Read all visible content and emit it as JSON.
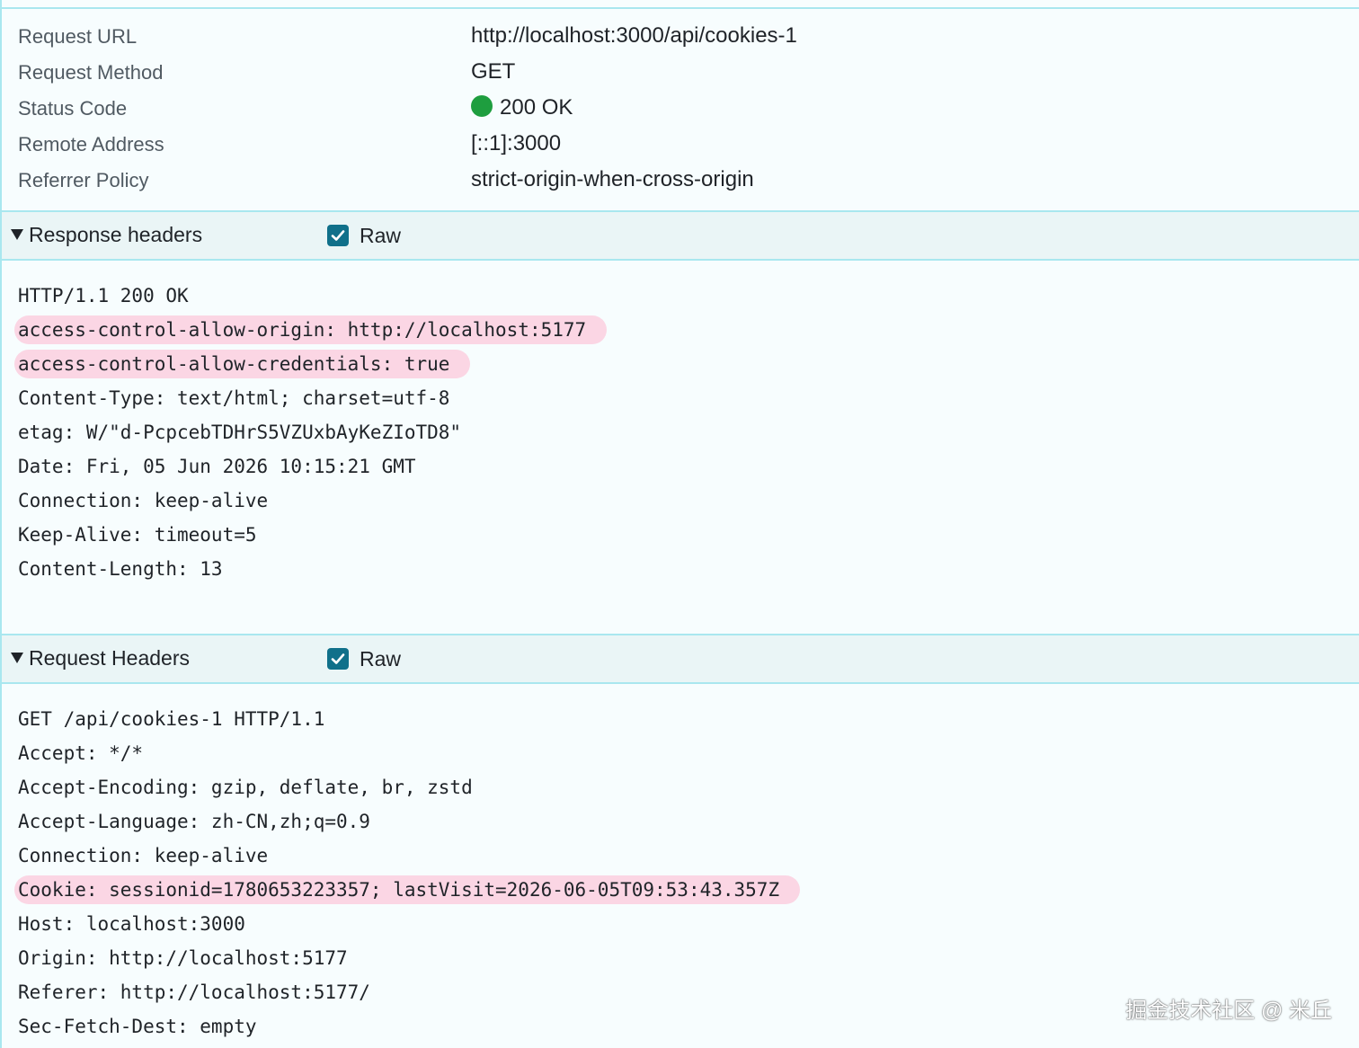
{
  "general": [
    {
      "key": "Request URL",
      "value": "http://localhost:3000/api/cookies-1"
    },
    {
      "key": "Request Method",
      "value": "GET"
    },
    {
      "key": "Status Code",
      "value": "200 OK"
    },
    {
      "key": "Remote Address",
      "value": "[::1]:3000"
    },
    {
      "key": "Referrer Policy",
      "value": "strict-origin-when-cross-origin"
    }
  ],
  "status_color": "#1e9e3f",
  "highlight_color": "#fbd6e4",
  "response_headers": {
    "title": "Response headers",
    "raw_label": "Raw",
    "raw_checked": true,
    "lines": [
      "HTTP/1.1 200 OK",
      "access-control-allow-origin: http://localhost:5177",
      "access-control-allow-credentials: true",
      "Content-Type: text/html; charset=utf-8",
      "etag: W/\"d-PcpcebTDHrS5VZUxbAyKeZIoTD8\"",
      "Date: Fri, 05 Jun 2026 10:15:21 GMT",
      "Connection: keep-alive",
      "Keep-Alive: timeout=5",
      "Content-Length: 13"
    ],
    "highlighted": [
      1,
      2
    ]
  },
  "request_headers": {
    "title": "Request Headers",
    "raw_label": "Raw",
    "raw_checked": true,
    "lines": [
      "GET /api/cookies-1 HTTP/1.1",
      "Accept: */*",
      "Accept-Encoding: gzip, deflate, br, zstd",
      "Accept-Language: zh-CN,zh;q=0.9",
      "Connection: keep-alive",
      "Cookie: sessionid=1780653223357; lastVisit=2026-06-05T09:53:43.357Z",
      "Host: localhost:3000",
      "Origin: http://localhost:5177",
      "Referer: http://localhost:5177/",
      "Sec-Fetch-Dest: empty"
    ],
    "highlighted": [
      5
    ]
  },
  "watermark": "掘金技术社区 @ 米丘"
}
